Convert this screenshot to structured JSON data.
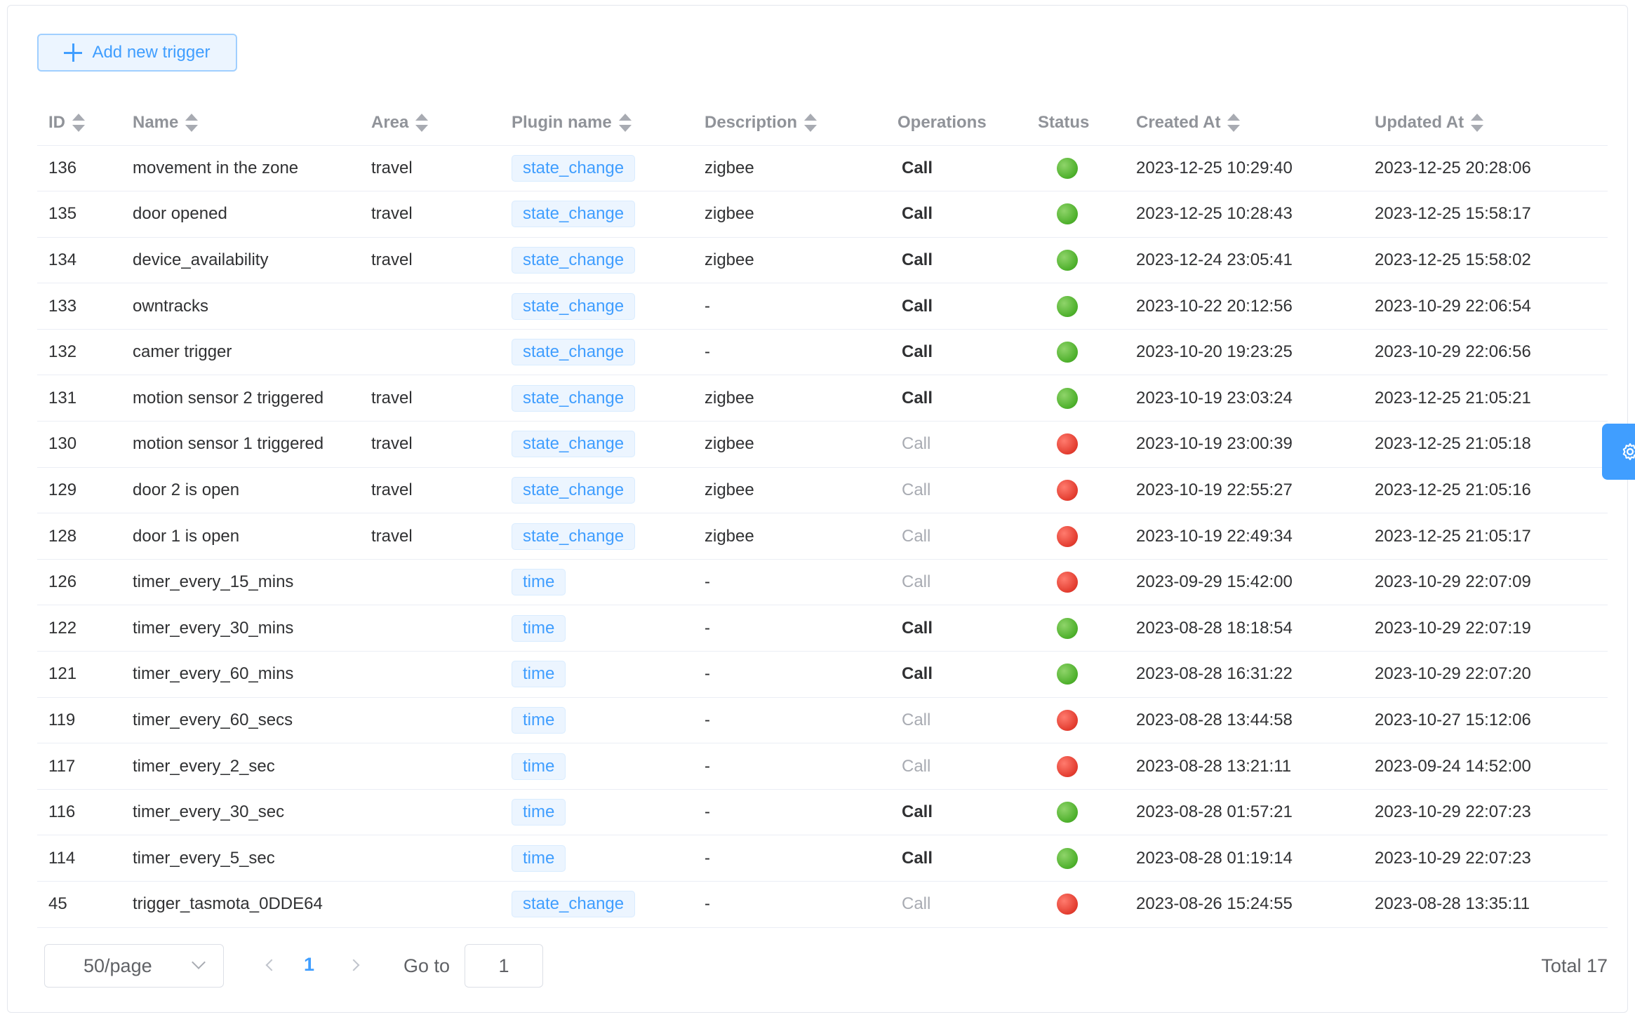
{
  "toolbar": {
    "add_label": "Add new trigger"
  },
  "table": {
    "columns": [
      {
        "label": "ID",
        "sortable": true
      },
      {
        "label": "Name",
        "sortable": true
      },
      {
        "label": "Area",
        "sortable": true
      },
      {
        "label": "Plugin name",
        "sortable": true
      },
      {
        "label": "Description",
        "sortable": true
      },
      {
        "label": "Operations",
        "sortable": false
      },
      {
        "label": "Status",
        "sortable": false
      },
      {
        "label": "Created At",
        "sortable": true
      },
      {
        "label": "Updated At",
        "sortable": true
      }
    ],
    "operation_label": "Call",
    "rows": [
      {
        "id": "136",
        "name": "movement in the zone",
        "area": "travel",
        "plugin": "state_change",
        "description": "zigbee",
        "enabled": true,
        "created": "2023-12-25 10:29:40",
        "updated": "2023-12-25 20:28:06"
      },
      {
        "id": "135",
        "name": "door opened",
        "area": "travel",
        "plugin": "state_change",
        "description": "zigbee",
        "enabled": true,
        "created": "2023-12-25 10:28:43",
        "updated": "2023-12-25 15:58:17"
      },
      {
        "id": "134",
        "name": "device_availability",
        "area": "travel",
        "plugin": "state_change",
        "description": "zigbee",
        "enabled": true,
        "created": "2023-12-24 23:05:41",
        "updated": "2023-12-25 15:58:02"
      },
      {
        "id": "133",
        "name": "owntracks",
        "area": "",
        "plugin": "state_change",
        "description": "-",
        "enabled": true,
        "created": "2023-10-22 20:12:56",
        "updated": "2023-10-29 22:06:54"
      },
      {
        "id": "132",
        "name": "camer trigger",
        "area": "",
        "plugin": "state_change",
        "description": "-",
        "enabled": true,
        "created": "2023-10-20 19:23:25",
        "updated": "2023-10-29 22:06:56"
      },
      {
        "id": "131",
        "name": "motion sensor 2 triggered",
        "area": "travel",
        "plugin": "state_change",
        "description": "zigbee",
        "enabled": true,
        "created": "2023-10-19 23:03:24",
        "updated": "2023-12-25 21:05:21"
      },
      {
        "id": "130",
        "name": "motion sensor 1 triggered",
        "area": "travel",
        "plugin": "state_change",
        "description": "zigbee",
        "enabled": false,
        "created": "2023-10-19 23:00:39",
        "updated": "2023-12-25 21:05:18"
      },
      {
        "id": "129",
        "name": "door 2 is open",
        "area": "travel",
        "plugin": "state_change",
        "description": "zigbee",
        "enabled": false,
        "created": "2023-10-19 22:55:27",
        "updated": "2023-12-25 21:05:16"
      },
      {
        "id": "128",
        "name": "door 1 is open",
        "area": "travel",
        "plugin": "state_change",
        "description": "zigbee",
        "enabled": false,
        "created": "2023-10-19 22:49:34",
        "updated": "2023-12-25 21:05:17"
      },
      {
        "id": "126",
        "name": "timer_every_15_mins",
        "area": "",
        "plugin": "time",
        "description": "-",
        "enabled": false,
        "created": "2023-09-29 15:42:00",
        "updated": "2023-10-29 22:07:09"
      },
      {
        "id": "122",
        "name": "timer_every_30_mins",
        "area": "",
        "plugin": "time",
        "description": "-",
        "enabled": true,
        "created": "2023-08-28 18:18:54",
        "updated": "2023-10-29 22:07:19"
      },
      {
        "id": "121",
        "name": "timer_every_60_mins",
        "area": "",
        "plugin": "time",
        "description": "-",
        "enabled": true,
        "created": "2023-08-28 16:31:22",
        "updated": "2023-10-29 22:07:20"
      },
      {
        "id": "119",
        "name": "timer_every_60_secs",
        "area": "",
        "plugin": "time",
        "description": "-",
        "enabled": false,
        "created": "2023-08-28 13:44:58",
        "updated": "2023-10-27 15:12:06"
      },
      {
        "id": "117",
        "name": "timer_every_2_sec",
        "area": "",
        "plugin": "time",
        "description": "-",
        "enabled": false,
        "created": "2023-08-28 13:21:11",
        "updated": "2023-09-24 14:52:00"
      },
      {
        "id": "116",
        "name": "timer_every_30_sec",
        "area": "",
        "plugin": "time",
        "description": "-",
        "enabled": true,
        "created": "2023-08-28 01:57:21",
        "updated": "2023-10-29 22:07:23"
      },
      {
        "id": "114",
        "name": "timer_every_5_sec",
        "area": "",
        "plugin": "time",
        "description": "-",
        "enabled": true,
        "created": "2023-08-28 01:19:14",
        "updated": "2023-10-29 22:07:23"
      },
      {
        "id": "45",
        "name": "trigger_tasmota_0DDE64",
        "area": "",
        "plugin": "state_change",
        "description": "-",
        "enabled": false,
        "created": "2023-08-26 15:24:55",
        "updated": "2023-08-28 13:35:11"
      }
    ]
  },
  "pagination": {
    "page_size": "50/page",
    "current_page": "1",
    "goto_label": "Go to",
    "goto_value": "1",
    "total": "Total 17"
  },
  "icons": {
    "add": "plus-icon",
    "sort": "sort-caret-icon",
    "status_on": "green-dot-icon",
    "status_off": "red-dot-icon",
    "settings": "gear-icon",
    "dropdown": "chevron-down-icon",
    "prev": "chevron-left-icon",
    "next": "chevron-right-icon"
  },
  "colors": {
    "accent": "#409eff",
    "status_on": "#4caf2a",
    "status_off": "#e23b2e"
  }
}
